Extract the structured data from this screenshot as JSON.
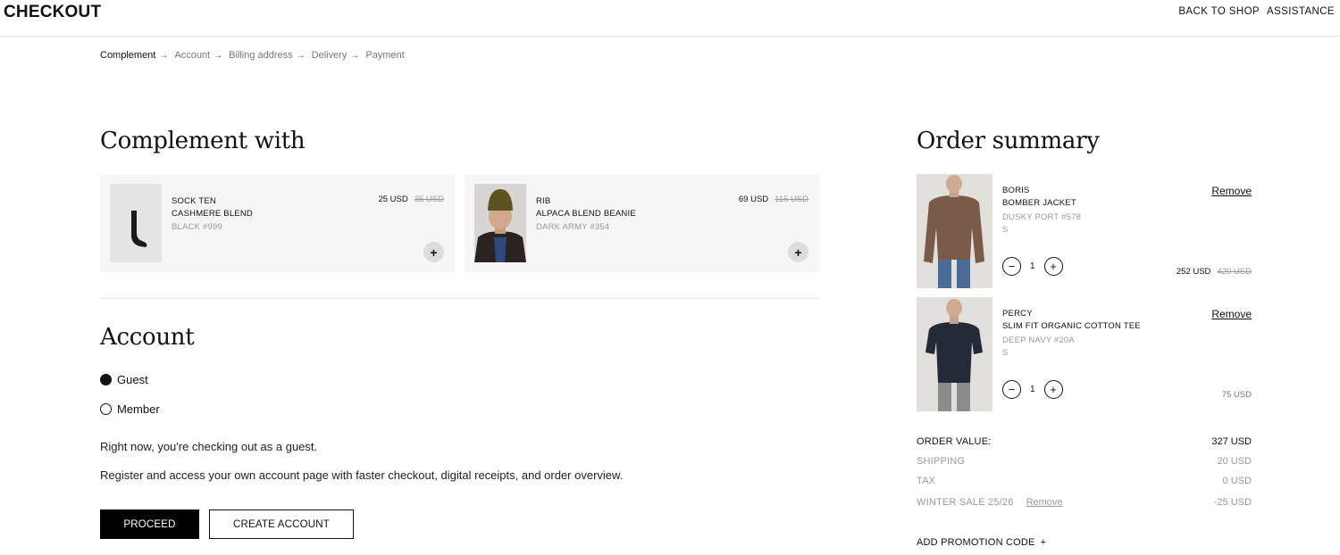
{
  "header": {
    "logo": "CHECKOUT",
    "back_to_shop": "BACK TO SHOP",
    "assistance": "ASSISTANCE"
  },
  "breadcrumb": [
    {
      "label": "Complement",
      "active": true
    },
    {
      "label": "Account",
      "active": false
    },
    {
      "label": "Billing address",
      "active": false
    },
    {
      "label": "Delivery",
      "active": false
    },
    {
      "label": "Payment",
      "active": false
    }
  ],
  "complement": {
    "title": "Complement with",
    "items": [
      {
        "name_line1": "SOCK TEN",
        "name_line2": "CASHMERE BLEND",
        "color": "BLACK #999",
        "price": "25 USD",
        "old_price": "35 USD",
        "add_label": "+"
      },
      {
        "name_line1": "RIB",
        "name_line2": "ALPACA BLEND BEANIE",
        "color": "DARK ARMY #354",
        "price": "69 USD",
        "old_price": "115 USD",
        "add_label": "+"
      }
    ]
  },
  "account": {
    "title": "Account",
    "options": [
      {
        "label": "Guest",
        "selected": true
      },
      {
        "label": "Member",
        "selected": false
      }
    ],
    "text1": "Right now, you're checking out as a guest.",
    "text2": "Register and access your own account page with faster checkout, digital receipts, and order overview.",
    "proceed": "PROCEED",
    "create_account": "CREATE ACCOUNT"
  },
  "summary": {
    "title": "Order summary",
    "items": [
      {
        "name_line1": "BORIS",
        "name_line2": "BOMBER JACKET",
        "color": "DUSKY PORT #578",
        "size": "S",
        "remove": "Remove",
        "qty": "1",
        "price": "252 USD",
        "old_price": "420 USD"
      },
      {
        "name_line1": "PERCY",
        "name_line2": "SLIM FIT ORGANIC COTTON TEE",
        "color": "DEEP NAVY #20A",
        "size": "S",
        "remove": "Remove",
        "qty": "1",
        "price": "75 USD",
        "old_price": ""
      }
    ],
    "order_value_label": "ORDER VALUE:",
    "order_value": "327 USD",
    "shipping_label": "SHIPPING",
    "shipping": "20 USD",
    "tax_label": "TAX",
    "tax": "0 USD",
    "discount_label": "WINTER SALE 25/26",
    "discount_remove": "Remove",
    "discount": "-25 USD",
    "promo_label": "ADD PROMOTION CODE"
  }
}
